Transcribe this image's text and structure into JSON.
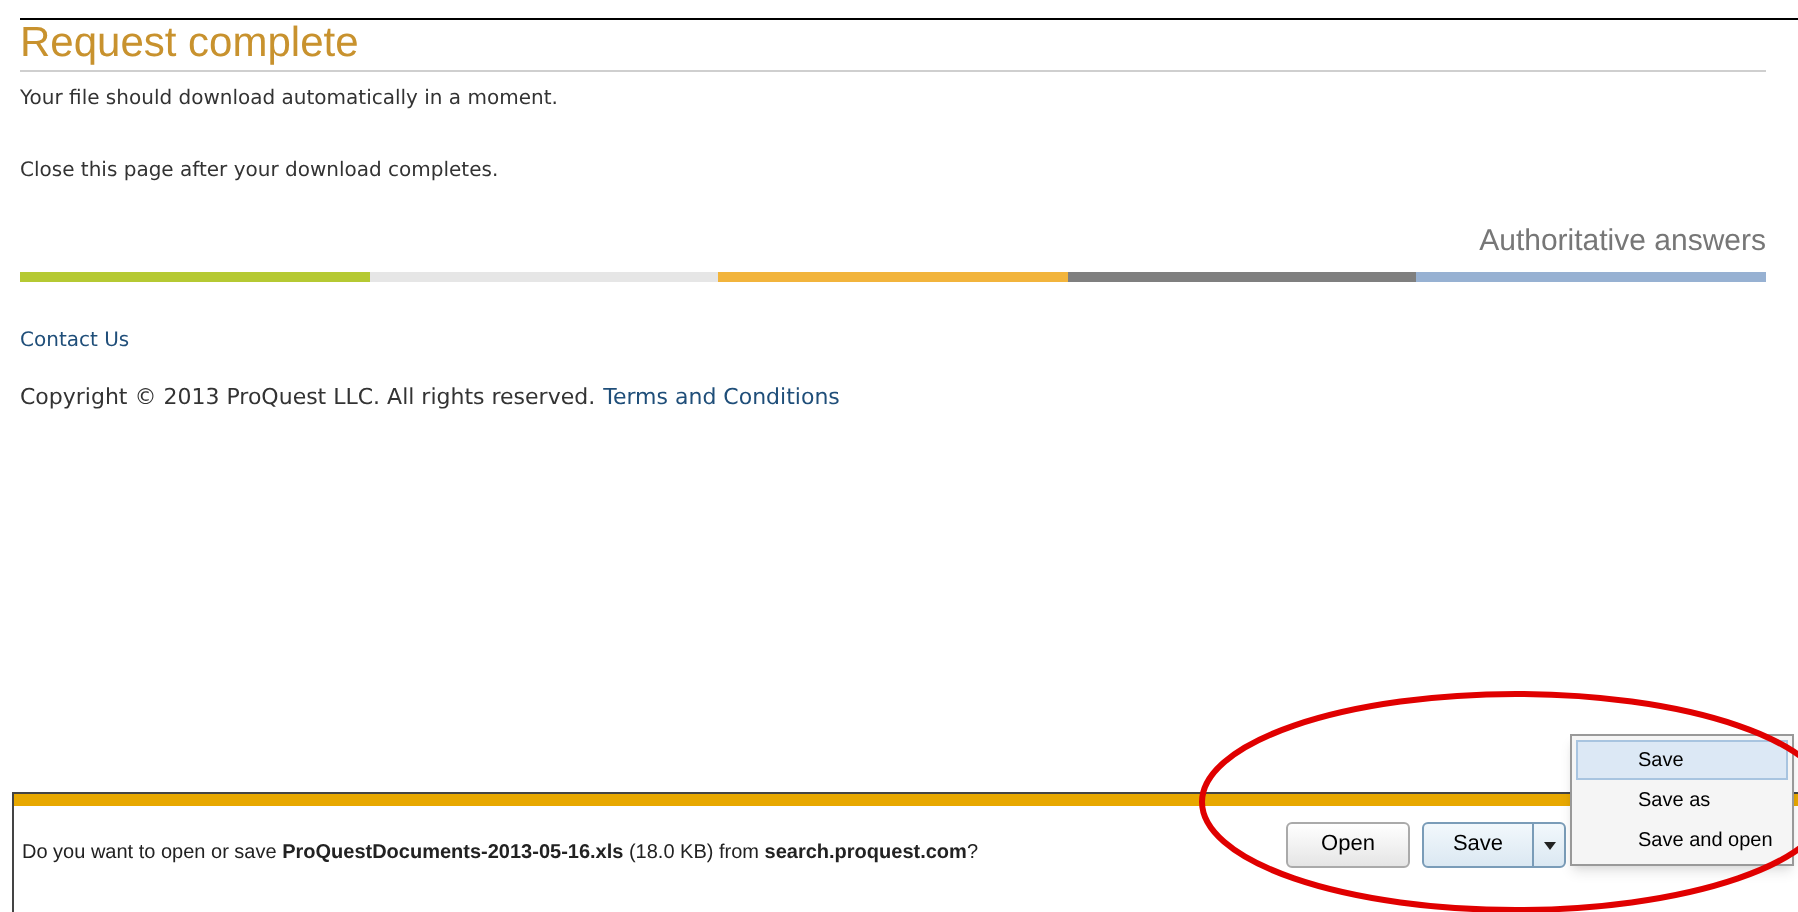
{
  "page": {
    "title": "Request complete",
    "messages": [
      "Your file should download automatically in a moment.",
      "Close this page after your download completes."
    ],
    "tagline": "Authoritative answers"
  },
  "color_band": [
    {
      "color": "#b5c932"
    },
    {
      "color": "#e6e6e6"
    },
    {
      "color": "#f2b43c"
    },
    {
      "color": "#7f7f7f"
    },
    {
      "color": "#97b1d2"
    }
  ],
  "footer": {
    "contact_link": "Contact Us",
    "copyright": "Copyright © 2013 ProQuest LLC. All rights reserved.",
    "terms_link": "Terms and Conditions"
  },
  "download_bar": {
    "prompt": "Do you want to open or save **ProQuestDocuments-2013-05-16.xls** (18.0 KB) from **search.proquest.com**?",
    "open_button": "Open",
    "save_button": "Save",
    "save_menu": [
      {
        "label": "Save",
        "selected": true
      },
      {
        "label": "Save as",
        "selected": false
      },
      {
        "label": "Save and open",
        "selected": false
      }
    ]
  }
}
